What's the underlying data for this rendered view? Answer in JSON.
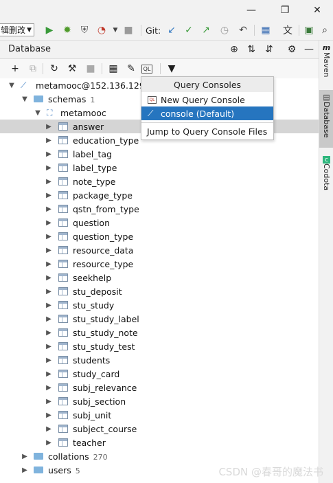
{
  "window": {
    "minimize": "—",
    "restore": "❐",
    "close": "✕"
  },
  "toolbar": {
    "config_select": "辑删改",
    "git_label": "Git:",
    "icons": [
      "run-icon",
      "debug-icon",
      "coverage-icon",
      "profile-icon",
      "more-run-icon",
      "stop-icon",
      "vcs-update-icon",
      "vcs-commit-icon",
      "vcs-push-icon",
      "history-icon",
      "rollback-icon",
      "project-structure-icon",
      "translate-icon",
      "terminal-icon",
      "search-icon"
    ]
  },
  "database_panel": {
    "title": "Database"
  },
  "rail": {
    "tabs": [
      "Maven",
      "Database",
      "Codota"
    ]
  },
  "tree": {
    "datasource": "metamooc@152.136.129.2",
    "schemas_label": "schemas",
    "schemas_count": "1",
    "schema_name": "metamooc",
    "tables": [
      "answer",
      "education_type",
      "label_tag",
      "label_type",
      "note_type",
      "package_type",
      "qstn_from_type",
      "question",
      "question_type",
      "resource_data",
      "resource_type",
      "seekhelp",
      "stu_deposit",
      "stu_study",
      "stu_study_label",
      "stu_study_note",
      "stu_study_test",
      "students",
      "study_card",
      "subj_relevance",
      "subj_section",
      "subj_unit",
      "subject_course",
      "teacher"
    ],
    "collations_label": "collations",
    "collations_count": "270",
    "users_label": "users",
    "users_count": "5"
  },
  "popup": {
    "header": "Query Consoles",
    "new_console": "New Query Console",
    "console_default": "console (Default)",
    "jump": "Jump to Query Console Files"
  },
  "watermark": "CSDN @春哥的魔法书",
  "colors": {
    "selection": "#2675bf",
    "run": "#3a9a3a",
    "accent_blue": "#3c7fc4"
  }
}
